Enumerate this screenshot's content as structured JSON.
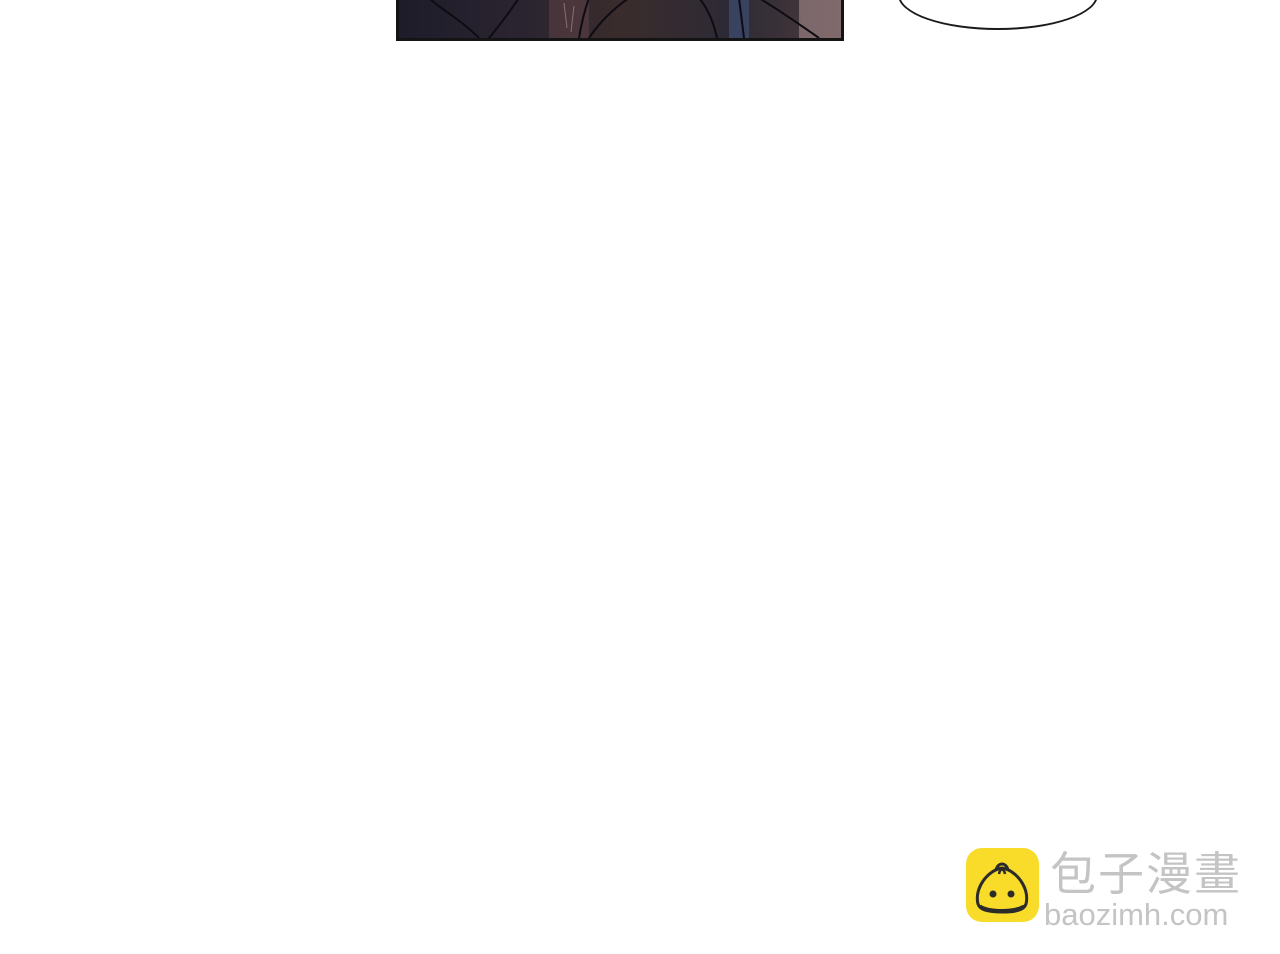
{
  "watermark": {
    "title": "包子漫畫",
    "url": "baozimh.com",
    "logo_icon": "steamed-bun-icon",
    "logo_color": "#f9db2a",
    "text_color": "#c4c4c4"
  },
  "colors": {
    "background": "#ffffff",
    "panel_border": "#141414",
    "bubble_border": "#1a1a1a"
  }
}
